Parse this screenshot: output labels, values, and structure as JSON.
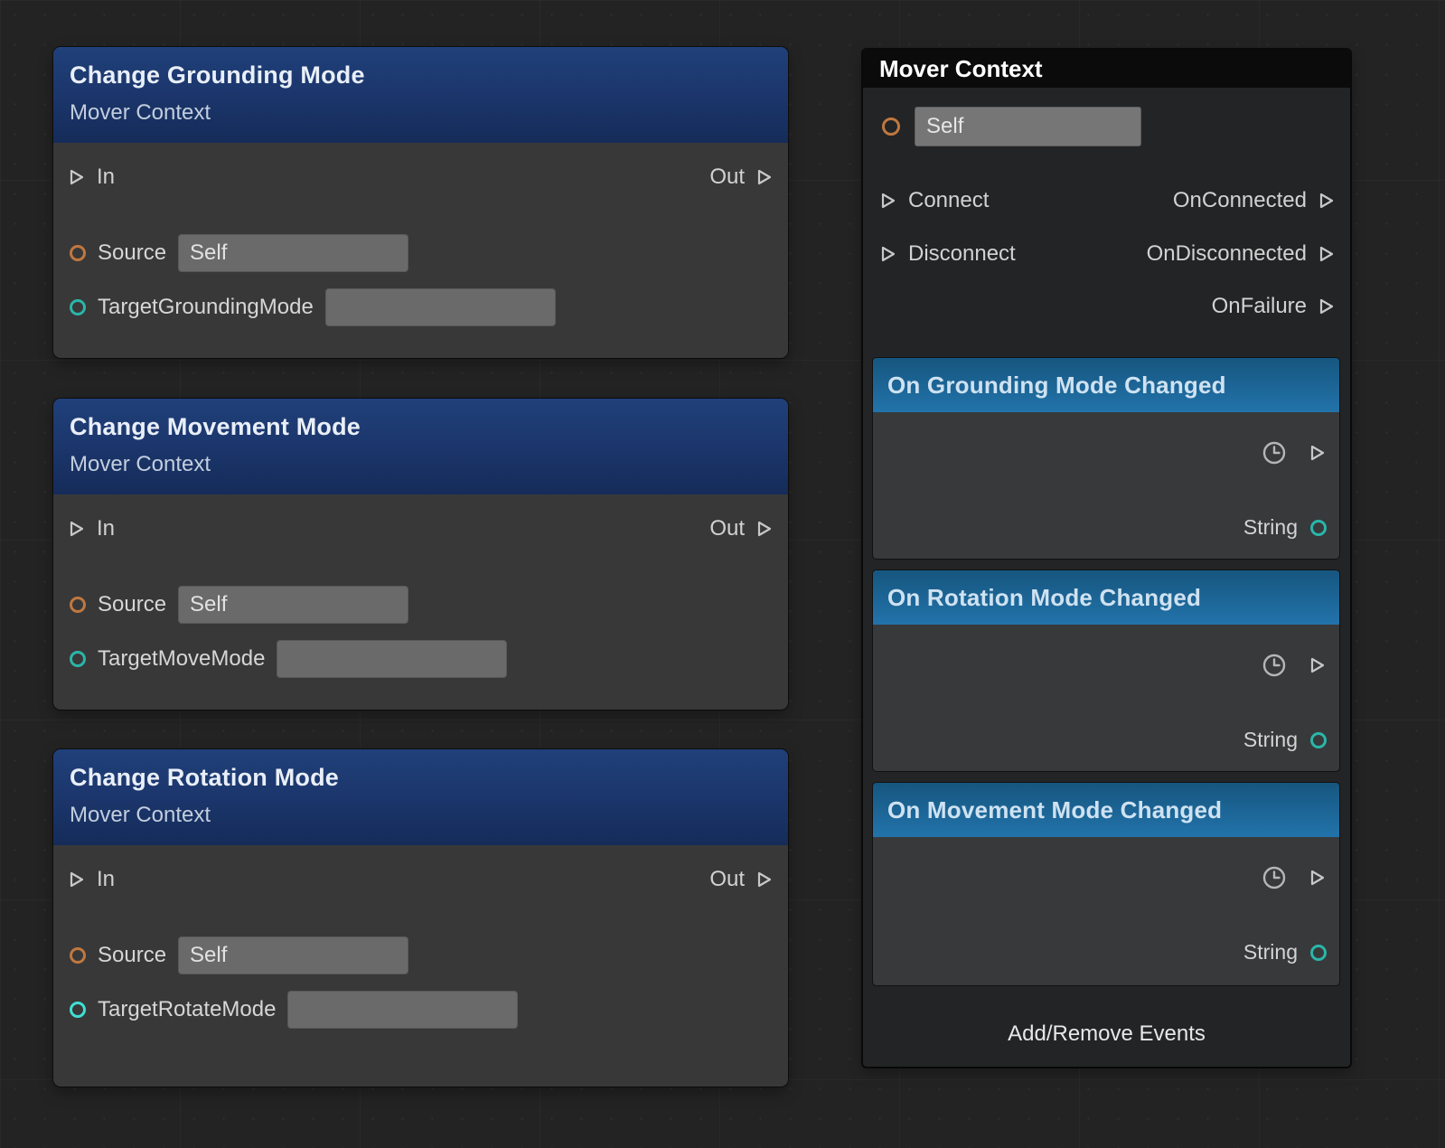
{
  "canvas": {
    "background": "#232323"
  },
  "left_nodes": [
    {
      "title": "Change Grounding Mode",
      "subtitle": "Mover Context",
      "in_label": "In",
      "out_label": "Out",
      "source": {
        "label": "Source",
        "value": "Self"
      },
      "target": {
        "label": "TargetGroundingMode",
        "value": ""
      }
    },
    {
      "title": "Change Movement Mode",
      "subtitle": "Mover Context",
      "in_label": "In",
      "out_label": "Out",
      "source": {
        "label": "Source",
        "value": "Self"
      },
      "target": {
        "label": "TargetMoveMode",
        "value": ""
      }
    },
    {
      "title": "Change Rotation Mode",
      "subtitle": "Mover Context",
      "in_label": "In",
      "out_label": "Out",
      "source": {
        "label": "Source",
        "value": "Self"
      },
      "target": {
        "label": "TargetRotateMode",
        "value": ""
      }
    }
  ],
  "right_node": {
    "title": "Mover Context",
    "self_input": {
      "value": "Self"
    },
    "flow_rows": [
      {
        "in_label": "Connect",
        "out_label": "OnConnected"
      },
      {
        "in_label": "Disconnect",
        "out_label": "OnDisconnected"
      },
      {
        "in_label": "",
        "out_label": "OnFailure"
      }
    ],
    "events": [
      {
        "title": "On Grounding Mode Changed",
        "output_label": "String"
      },
      {
        "title": "On Rotation Mode Changed",
        "output_label": "String"
      },
      {
        "title": "On Movement Mode Changed",
        "output_label": "String"
      }
    ],
    "footer_label": "Add/Remove Events"
  },
  "colors": {
    "background": "#232323",
    "node_body": "#383838",
    "left_header_top": "#20407a",
    "left_header_bottom": "#152c59",
    "event_header_top": "#16567f",
    "event_header_bottom": "#2273ab",
    "right_header": "#0b0b0b",
    "right_body": "#232425",
    "field_fill": "#6a6a6a",
    "port_orange": "#bf7840",
    "port_teal": "#2ab6a9",
    "port_cyan_bright": "#3fe0d4"
  }
}
